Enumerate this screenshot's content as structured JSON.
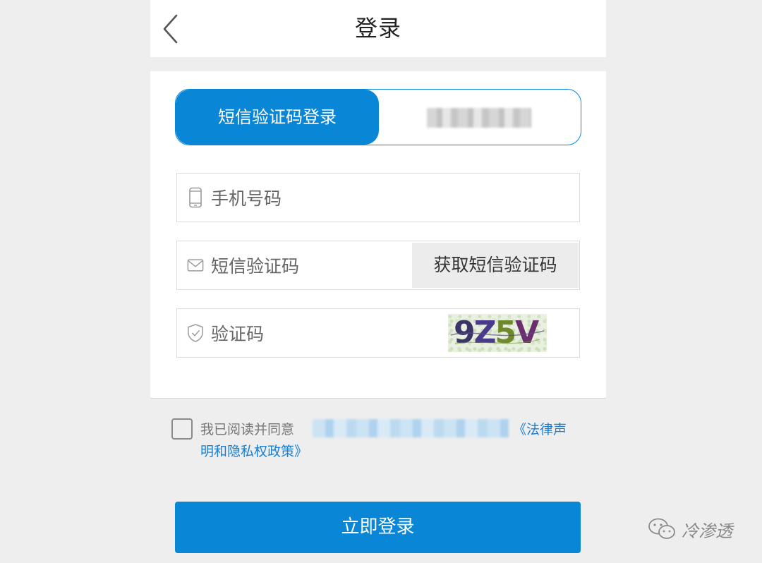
{
  "header": {
    "title": "登录",
    "back_icon": "chevron-left-icon"
  },
  "tabs": {
    "active_label": "短信验证码登录"
  },
  "form": {
    "phone": {
      "placeholder": "手机号码",
      "icon": "phone-icon"
    },
    "sms_code": {
      "placeholder": "短信验证码",
      "icon": "mail-icon",
      "button_label": "获取短信验证码"
    },
    "captcha": {
      "placeholder": "验证码",
      "icon": "shield-check-icon",
      "image_text": "9Z5V"
    }
  },
  "agreement": {
    "prefix": "我已阅读并同意",
    "link_part1": "《法律声",
    "link_part2": "明和隐私权政策》",
    "checked": false
  },
  "login_button": {
    "label": "立即登录"
  },
  "watermark": {
    "text": "冷渗透",
    "icon": "wechat-icon"
  },
  "colors": {
    "primary": "#0a86d6",
    "link": "#1a7fd0",
    "background": "#eeeeee"
  }
}
